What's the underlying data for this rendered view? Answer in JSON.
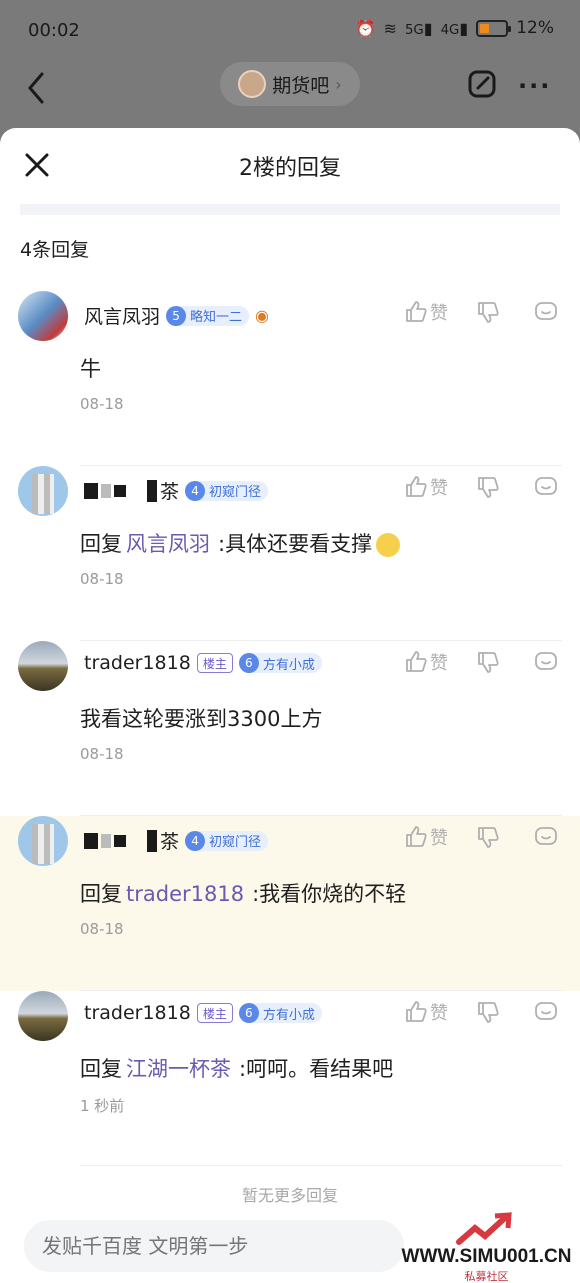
{
  "status_bar": {
    "time": "00:02",
    "network_5g": "5G",
    "network_4g": "4G",
    "battery_percent": "12%",
    "battery_level": 0.12
  },
  "topbar": {
    "forum_name": "期货吧",
    "more": "···"
  },
  "sheet": {
    "title": "2楼的回复",
    "reply_count": "4条回复",
    "no_more": "暂无更多回复",
    "input_placeholder": "发贴千百度 文明第一步"
  },
  "replies": [
    {
      "username": "风言凤羽",
      "level": "5",
      "level_title": "略知一二",
      "owner": "",
      "like_label": "赞",
      "prefix": "",
      "target": "",
      "content": "牛",
      "time": "08-18"
    },
    {
      "username": "茶",
      "level": "4",
      "level_title": "初窥门径",
      "owner": "",
      "like_label": "赞",
      "prefix": "回复",
      "target": "风言凤羽",
      "content": ":具体还要看支撑",
      "time": "08-18"
    },
    {
      "username": "trader1818",
      "level": "6",
      "level_title": "方有小成",
      "owner": "楼主",
      "like_label": "赞",
      "prefix": "",
      "target": "",
      "content": "我看这轮要涨到3300上方",
      "time": "08-18"
    },
    {
      "username": "茶",
      "level": "4",
      "level_title": "初窥门径",
      "owner": "",
      "like_label": "赞",
      "prefix": "回复",
      "target": "trader1818",
      "content": ":我看你烧的不轻",
      "time": "08-18"
    },
    {
      "username": "trader1818",
      "level": "6",
      "level_title": "方有小成",
      "owner": "楼主",
      "like_label": "赞",
      "prefix": "回复",
      "target": "江湖一杯茶",
      "content": ":呵呵。看结果吧",
      "time": "1 秒前"
    }
  ],
  "watermark": {
    "site": "WWW.SIMU001.CN",
    "sub": "私募社区"
  },
  "colors": {
    "accent": "#6a5ab0",
    "level_badge": "#5a88e8",
    "highlight_bg": "#fcf8ea",
    "watermark_red": "#c0303a"
  }
}
